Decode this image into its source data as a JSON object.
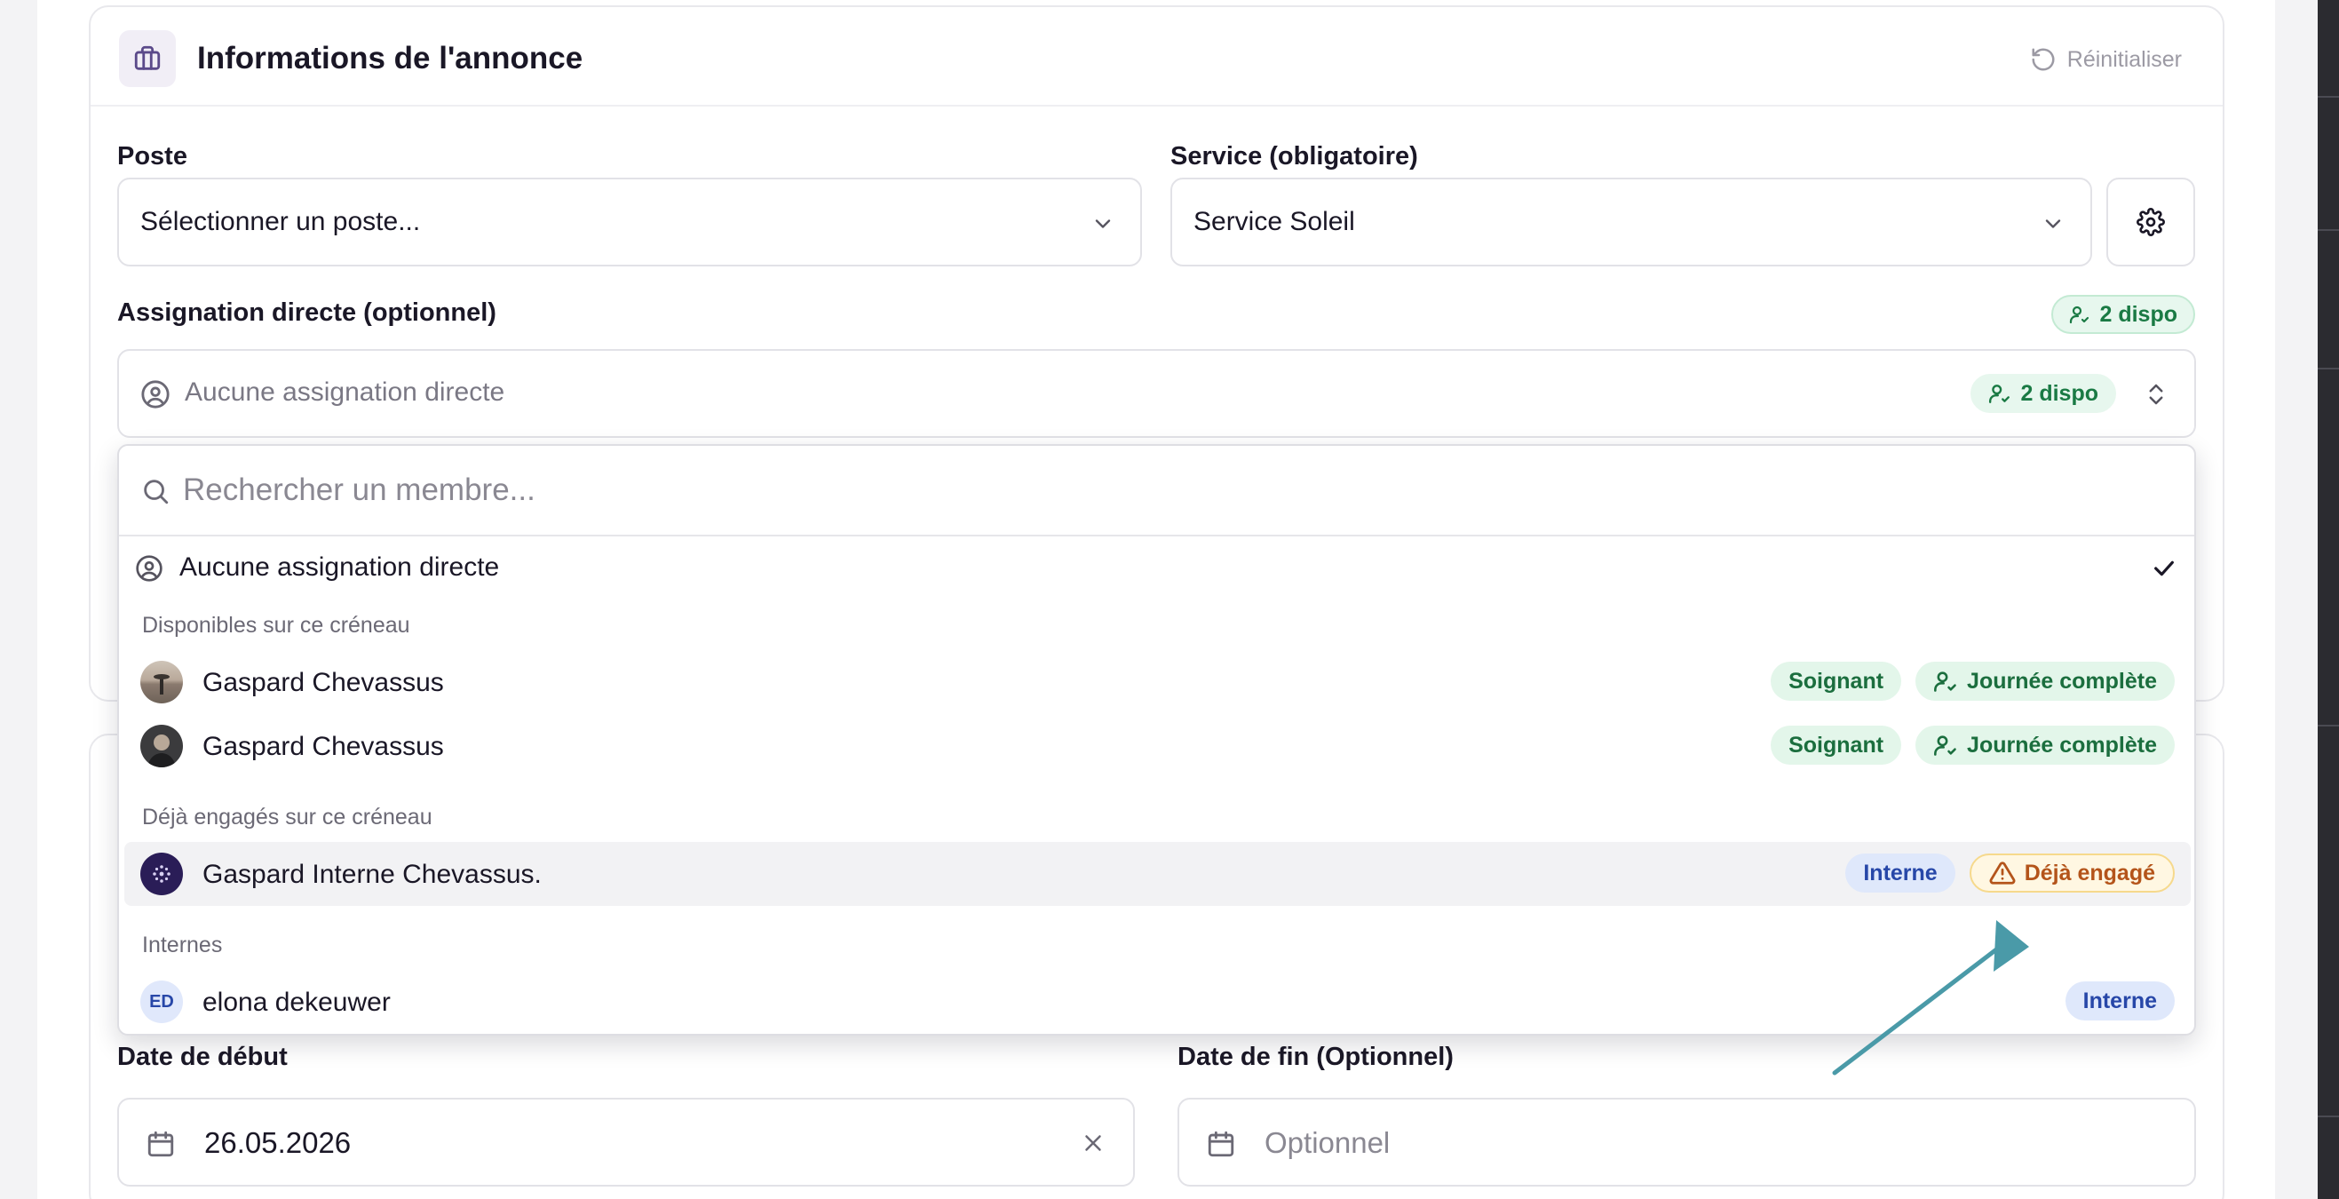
{
  "card": {
    "title": "Informations de l'annonce",
    "reset_label": "Réinitialiser"
  },
  "poste": {
    "label": "Poste",
    "value": "Sélectionner un poste..."
  },
  "service": {
    "label": "Service (obligatoire)",
    "value": "Service Soleil"
  },
  "assignation": {
    "label": "Assignation directe (optionnel)",
    "available_badge": "2 dispo",
    "placeholder": "Aucune assignation directe",
    "combo_badge": "2 dispo"
  },
  "dropdown": {
    "search_placeholder": "Rechercher un membre...",
    "none_option": "Aucune assignation directe",
    "groups": [
      {
        "label": "Disponibles sur ce créneau",
        "members": [
          {
            "name": "Gaspard Chevassus",
            "role": "Soignant",
            "availability": "Journée complète"
          },
          {
            "name": "Gaspard Chevassus",
            "role": "Soignant",
            "availability": "Journée complète"
          }
        ]
      },
      {
        "label": "Déjà engagés sur ce créneau",
        "members": [
          {
            "name": "Gaspard Interne Chevassus.",
            "role": "Interne",
            "status": "Déjà engagé"
          }
        ]
      },
      {
        "label": "Internes",
        "members": [
          {
            "initials": "ED",
            "name": "elona dekeuwer",
            "role": "Interne"
          }
        ]
      }
    ]
  },
  "dates": {
    "start_label": "Date de début",
    "start_value": "26.05.2026",
    "end_label": "Date de fin (Optionnel)",
    "end_placeholder": "Optionnel"
  },
  "colors": {
    "accent_purple": "#6a4f9c",
    "green_badge": "#1a7a44",
    "blue_badge": "#2747a8",
    "warning": "#b4541a",
    "arrow": "#4a9aa8"
  }
}
